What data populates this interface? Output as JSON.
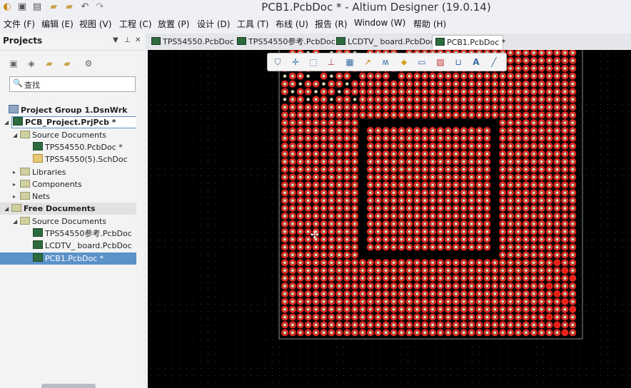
{
  "window": {
    "title": "PCB1.PcbDoc * - Altium Designer (19.0.14)",
    "quick_access": [
      "app-logo-icon",
      "save-icon",
      "save-all-icon",
      "open-icon",
      "open-project-icon",
      "undo-icon",
      "redo-icon"
    ]
  },
  "menu": [
    "文件 (F)",
    "编辑 (E)",
    "视图 (V)",
    "工程 (C)",
    "放置 (P)",
    "设计 (D)",
    "工具 (T)",
    "布线 (U)",
    "报告 (R)",
    "Window (W)",
    "帮助 (H)"
  ],
  "projects_panel": {
    "title": "Projects",
    "header_icons": [
      "dropdown-icon",
      "pin-icon",
      "close-icon"
    ],
    "toolbar_icons": [
      "save-icon",
      "compile-icon",
      "open-icon",
      "folder-icon",
      "settings-icon"
    ],
    "search_placeholder": "查找",
    "tree": [
      {
        "label": "Project Group 1.DsnWrk",
        "level": 0,
        "icon": "group",
        "bold": true,
        "expander": ""
      },
      {
        "label": "PCB_Project.PrjPcb *",
        "level": 1,
        "icon": "project",
        "bold": true,
        "expander": "◢",
        "outlined": true
      },
      {
        "label": "Source Documents",
        "level": 2,
        "icon": "folder",
        "expander": "◢"
      },
      {
        "label": "TPS54550.PcbDoc *",
        "level": 3,
        "icon": "pcb",
        "expander": ""
      },
      {
        "label": "TPS54550(5).SchDoc",
        "level": 3,
        "icon": "sch",
        "expander": ""
      },
      {
        "label": "Libraries",
        "level": 2,
        "icon": "folder",
        "expander": "▸"
      },
      {
        "label": "Components",
        "level": 2,
        "icon": "folder",
        "expander": "▸"
      },
      {
        "label": "Nets",
        "level": 2,
        "icon": "folder",
        "expander": "▸"
      },
      {
        "label": "Free Documents",
        "level": 1,
        "icon": "folder",
        "bold": true,
        "expander": "◢",
        "shaded": true
      },
      {
        "label": "Source Documents",
        "level": 2,
        "icon": "folder",
        "expander": "◢"
      },
      {
        "label": "TPS54550参考.PcbDoc",
        "level": 3,
        "icon": "pcb",
        "expander": ""
      },
      {
        "label": "LCDTV_ board.PcbDoc",
        "level": 3,
        "icon": "pcb",
        "expander": ""
      },
      {
        "label": "PCB1.PcbDoc *",
        "level": 3,
        "icon": "pcb",
        "expander": "",
        "selected": true
      }
    ]
  },
  "tabs": [
    {
      "label": "TPS54550.PcbDoc *",
      "active": false
    },
    {
      "label": "TPS54550参考.PcbDoc *",
      "active": false
    },
    {
      "label": "LCDTV_ board.PcbDoc *",
      "active": false
    },
    {
      "label": "PCB1.PcbDoc *",
      "active": true
    }
  ],
  "pcb_toolbar": [
    "filter-icon",
    "crosshair-icon",
    "select-rect-icon",
    "align-icon",
    "component-icon",
    "interactive-route-icon",
    "diff-pair-icon",
    "polygon-pour-icon",
    "layer-icon",
    "keepout-icon",
    "dimension-icon",
    "text-icon",
    "line-icon"
  ],
  "colors": {
    "pad_red": "#e8231a",
    "drill_hole": "#f2e8c8",
    "via_ring": "#7a7a6a",
    "board_outline": "#8a8a8a",
    "canvas_bg": "#000000",
    "selection": "#5b93c9"
  }
}
